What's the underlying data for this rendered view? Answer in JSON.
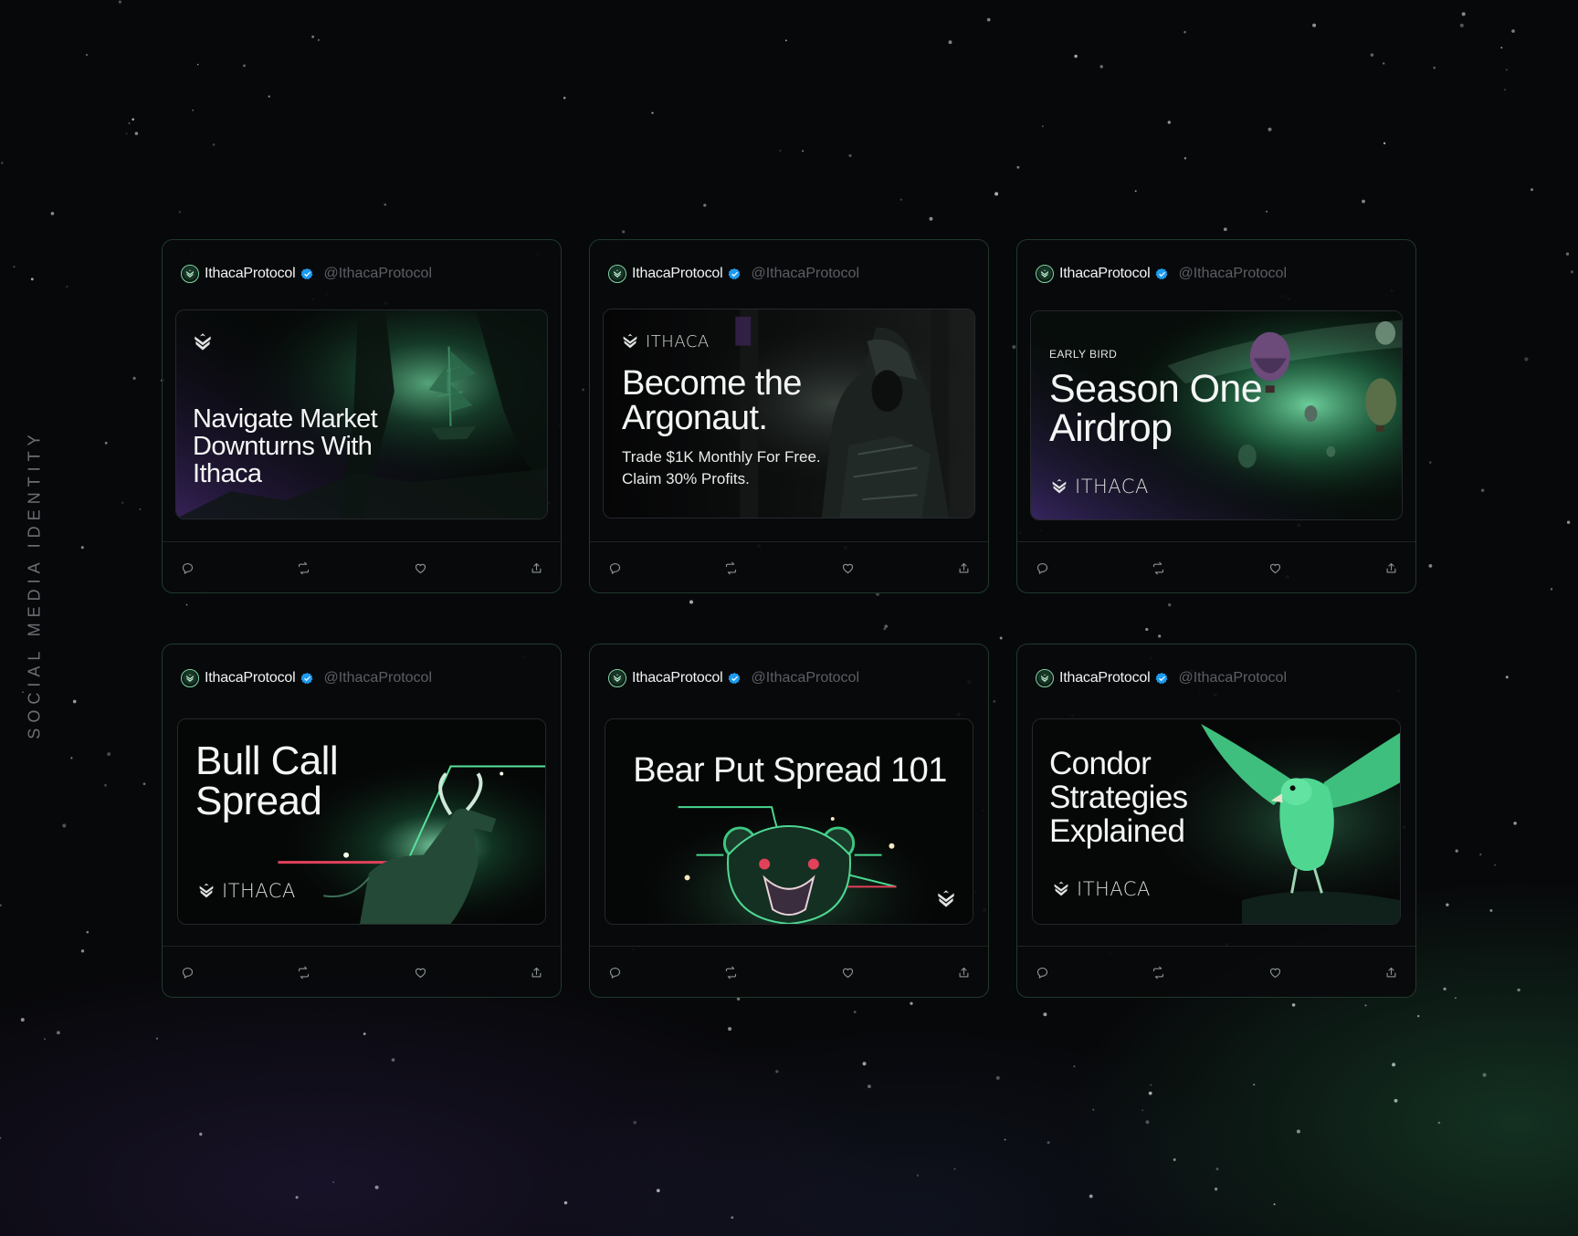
{
  "side_label": "SOCIAL MEDIA IDENTITY",
  "colors": {
    "accent_green": "#5fe3a1",
    "verified_blue": "#1d9bf0",
    "background": "#07080a",
    "card_border": "#1f3a2b"
  },
  "icons": {
    "reply": "reply-icon",
    "retweet": "retweet-icon",
    "like": "like-icon",
    "share": "share-icon",
    "verified": "verified-icon",
    "logo": "ithaca-logo-icon"
  },
  "cards": [
    {
      "display_name": "IthacaProtocol",
      "handle": "@IthacaProtocol",
      "headline": "Navigate Market Downturns With Ithaca"
    },
    {
      "display_name": "IthacaProtocol",
      "handle": "@IthacaProtocol",
      "brand": "ITHACA",
      "headline": "Become the Argonaut.",
      "subline_1": "Trade $1K Monthly For Free.",
      "subline_2": "Claim 30% Profits."
    },
    {
      "display_name": "IthacaProtocol",
      "handle": "@IthacaProtocol",
      "eyebrow": "EARLY BIRD",
      "headline": "Season One Airdrop",
      "brand": "ITHACA"
    },
    {
      "display_name": "IthacaProtocol",
      "handle": "@IthacaProtocol",
      "headline": "Bull Call Spread",
      "brand": "ITHACA"
    },
    {
      "display_name": "IthacaProtocol",
      "handle": "@IthacaProtocol",
      "headline": "Bear Put Spread 101"
    },
    {
      "display_name": "IthacaProtocol",
      "handle": "@IthacaProtocol",
      "headline": "Condor Strategies Explained",
      "brand": "ITHACA"
    }
  ]
}
